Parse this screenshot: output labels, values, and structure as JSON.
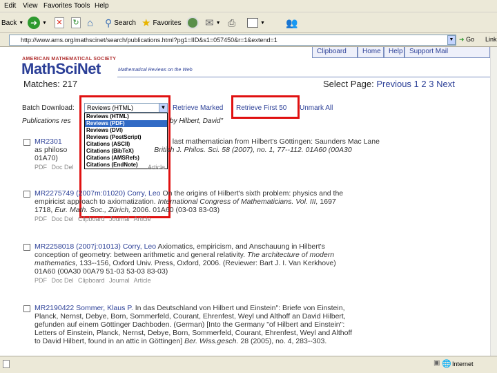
{
  "menu": [
    "Edit",
    "View",
    "Favorites",
    "Tools",
    "Help"
  ],
  "toolbar": {
    "back": "Back",
    "search": "Search",
    "favorites": "Favorites"
  },
  "address": {
    "url": "http://www.ams.org/mathscinet/search/publications.html?pg1=IID&s1=057450&r=1&extend=1",
    "go": "Go",
    "links": "Links"
  },
  "site": {
    "society": "AMERICAN MATHEMATICAL SOCIETY",
    "logo": "MathSciNet",
    "tagline": "Mathematical Reviews on the Web",
    "nav": [
      "Clipboard",
      "Home",
      "Help",
      "Support Mail"
    ]
  },
  "results": {
    "matches_label": "Matches: 217",
    "select_page_label": "Select Page:",
    "previous": "Previous",
    "pages": [
      "1",
      "2",
      "3"
    ],
    "next": "Next"
  },
  "batch": {
    "label": "Batch Download:",
    "selected": "Reviews (HTML)",
    "options": [
      "Reviews (HTML)",
      "Reviews (PDF)",
      "Reviews (DVI)",
      "Reviews (PostScript)",
      "Citations (ASCII)",
      "Citations (BibTeX)",
      "Citations (AMSRefs)",
      "Citations (EndNote)"
    ],
    "highlighted_index": 1,
    "retrieve_marked": "Retrieve Marked",
    "retrieve_first": "Retrieve First 50",
    "unmark_all": "Unmark All"
  },
  "publications_header": {
    "left": "Publications res",
    "right": "by Hilbert, David\""
  },
  "entries": [
    {
      "mr": "MR2301",
      "line1_tail": "last mathematician from Hilbert's Göttingen: Saunders Mac Lane",
      "line2": "as philoso",
      "line2_tail": "British J. Philos. Sci. 58 (2007), no. 1, 77--112. 01A60 (00A30",
      "line3": "01A70)",
      "links": [
        "PDF",
        "Doc Del",
        "Clipboard",
        "Journal",
        "Article"
      ]
    },
    {
      "mr": "MR2275749 (2007m:01020)",
      "author": "Corry, Leo",
      "title": "On the origins of Hilbert's sixth problem: physics and the",
      "line2": "empiricist approach to axiomatization.",
      "line2_italic": "International Congress of Mathematicians. Vol. III,",
      "line2_tail": "1697",
      "line3_a": "1718,",
      "line3_italic": "Eur. Math. Soc., Zürich,",
      "line3_tail": "2006. 01A60 (03-03 83-03)",
      "links": [
        "PDF",
        "Doc Del",
        "Clipboard",
        "Journal",
        "Article"
      ]
    },
    {
      "mr": "MR2258018 (2007j:01013)",
      "author": "Corry, Leo",
      "title": "Axiomatics, empiricism, and Anschauung in Hilbert's",
      "line2": "conception of geometry: between arithmetic and general relativity.",
      "line2_italic": "The architecture of modern",
      "line3_italic": "mathematics,",
      "line3_tail": "133--156, Oxford Univ. Press, Oxford, 2006. (Reviewer: Bart J. I. Van Kerkhove)",
      "line4": "01A60 (00A30 00A79 51-03 53-03 83-03)",
      "links": [
        "PDF",
        "Doc Del",
        "Clipboard",
        "Journal",
        "Article"
      ]
    },
    {
      "mr": "MR2190422",
      "author": "Sommer, Klaus P.",
      "title": "In das Deutschland von Hilbert und Einstein\": Briefe von Einstein,",
      "line2": "Planck, Nernst, Debye, Born, Sommerfeld, Courant, Ehrenfest, Weyl und Althoff an David Hilbert,",
      "line3": "gefunden auf einem Göttinger Dachboden. (German) [Into the Germany \"of Hilbert and Einstein\":",
      "line4": "Letters of Einstein, Planck, Nernst, Debye, Born, Sommerfeld, Courant, Ehrenfest, Weyl and Althoff",
      "line5_a": "to David Hilbert, found in an attic in Göttingen]",
      "line5_italic": "Ber. Wiss.gesch.",
      "line5_tail": "28 (2005), no. 4, 283--303."
    }
  ],
  "status": {
    "zone": "Internet"
  }
}
